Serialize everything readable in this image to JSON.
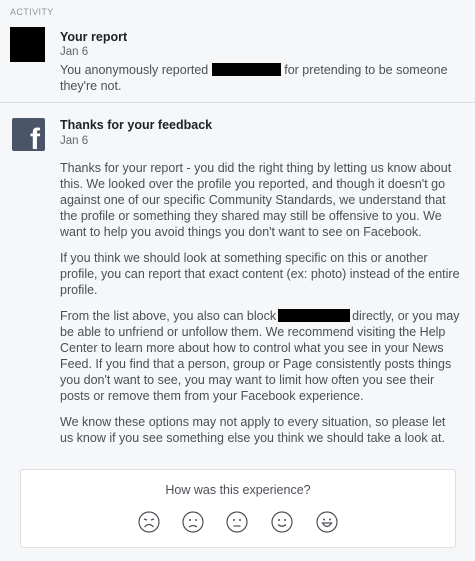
{
  "section": {
    "label": "ACTIVITY"
  },
  "report": {
    "title": "Your report",
    "date": "Jan 6",
    "text_before": "You anonymously reported",
    "text_after": "for pretending to be someone",
    "text_line2": "they're not."
  },
  "feedback": {
    "title": "Thanks for your feedback",
    "date": "Jan 6",
    "p1": "Thanks for your report - you did the right thing by letting us know about this. We looked over the profile you reported, and though it doesn't go against one of our specific Community Standards, we understand that the profile or something they shared may still be offensive to you. We want to help you avoid things you don't want to see on Facebook.",
    "p2": "If you think we should look at something specific on this or another profile, you can report that exact content (ex: photo) instead of the entire profile.",
    "p3_before": "From the list above, you also can block",
    "p3_after": "directly, or you may be able to unfriend or unfollow them. We recommend visiting the Help Center to learn more about how to control what you see in your News Feed. If you find that a person, group or Page consistently posts things you don't want to see, you may want to limit how often you see their posts or remove them from your Facebook experience.",
    "p4": "We know these options may not apply to every situation, so please let us know if you see something else you think we should take a look at."
  },
  "survey": {
    "question": "How was this experience?",
    "faces": [
      "very-sad-face-icon",
      "sad-face-icon",
      "neutral-face-icon",
      "happy-face-icon",
      "very-happy-face-icon"
    ]
  },
  "colors": {
    "icon": "#4a5568",
    "redaction": "#000000",
    "face_stroke": "#4b4f56"
  }
}
